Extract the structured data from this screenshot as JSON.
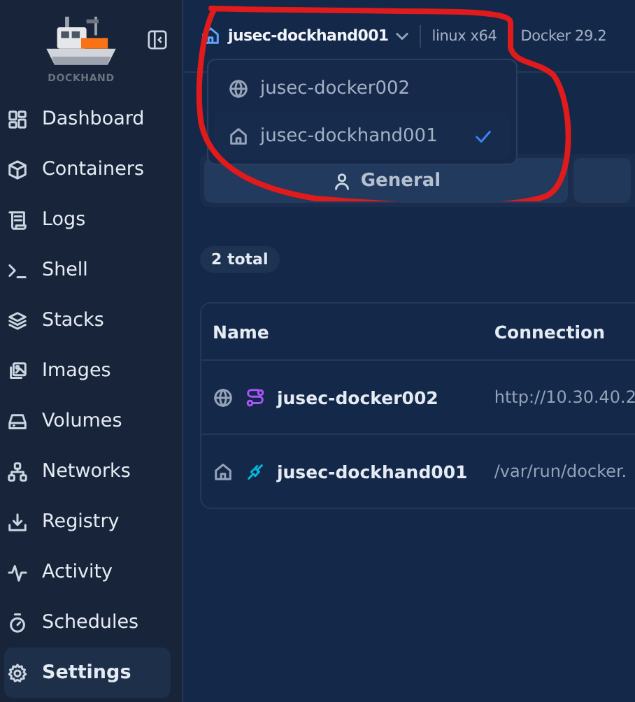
{
  "sidebar": {
    "logo": "DOCKHAND",
    "items": [
      {
        "label": "Dashboard",
        "selected": false
      },
      {
        "label": "Containers",
        "selected": false
      },
      {
        "label": "Logs",
        "selected": false
      },
      {
        "label": "Shell",
        "selected": false
      },
      {
        "label": "Stacks",
        "selected": false
      },
      {
        "label": "Images",
        "selected": false
      },
      {
        "label": "Volumes",
        "selected": false
      },
      {
        "label": "Networks",
        "selected": false
      },
      {
        "label": "Registry",
        "selected": false
      },
      {
        "label": "Activity",
        "selected": false
      },
      {
        "label": "Schedules",
        "selected": false
      },
      {
        "label": "Settings",
        "selected": true
      }
    ]
  },
  "header": {
    "environment": "jusec-dockhand001",
    "info": [
      "linux x64",
      "Docker 29.2"
    ]
  },
  "environment_menu": {
    "items": [
      {
        "name": "jusec-docker002",
        "kind": "remote",
        "selected": false
      },
      {
        "name": "jusec-dockhand001",
        "kind": "local",
        "selected": true
      }
    ]
  },
  "tabs": [
    {
      "label": "General",
      "selected": true
    }
  ],
  "total_badge": "2 total",
  "table": {
    "columns": [
      "Name",
      "Connection"
    ],
    "rows": [
      {
        "kind": "remote",
        "name": "jusec-docker002",
        "connection": "http://10.30.40.2"
      },
      {
        "kind": "local",
        "name": "jusec-dockhand001",
        "connection": "/var/run/docker."
      }
    ]
  }
}
